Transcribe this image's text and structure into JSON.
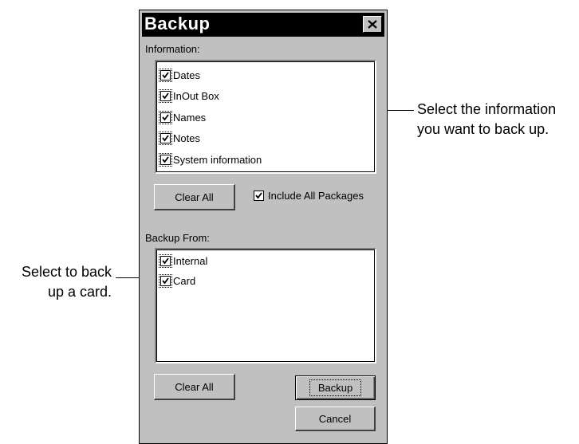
{
  "callouts": {
    "right_line1": "Select the information",
    "right_line2": "you want to back up.",
    "left_line1": "Select to back",
    "left_line2": "up a card."
  },
  "window": {
    "title": "Backup",
    "close_label": "✕"
  },
  "information": {
    "label": "Information:",
    "items": [
      {
        "label": "Dates",
        "checked": true
      },
      {
        "label": "InOut Box",
        "checked": true
      },
      {
        "label": "Names",
        "checked": true
      },
      {
        "label": "Notes",
        "checked": true
      },
      {
        "label": "System information",
        "checked": true
      }
    ],
    "clear_all_label": "Clear All",
    "include_packages_label": "Include All Packages",
    "include_packages_checked": true
  },
  "backup_from": {
    "label": "Backup From:",
    "items": [
      {
        "label": "Internal",
        "checked": true
      },
      {
        "label": "Card",
        "checked": true
      }
    ],
    "clear_all_label": "Clear All"
  },
  "actions": {
    "backup_label": "Backup",
    "cancel_label": "Cancel"
  }
}
